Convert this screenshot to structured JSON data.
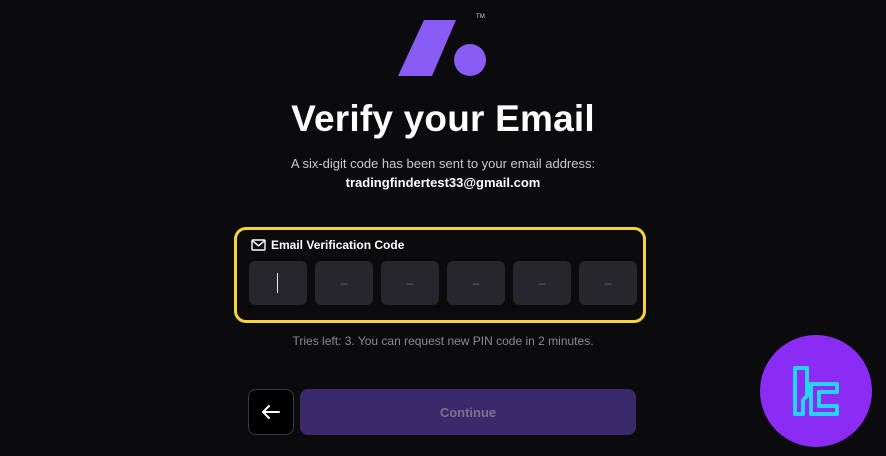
{
  "colors": {
    "background": "#0b0b0d",
    "brand_purple": "#8a5cf6",
    "highlight_yellow": "#f5d33b",
    "digit_box": "#27272b",
    "continue_disabled": "#3a2a6b",
    "badge_purple": "#8b2cf5",
    "badge_cyan": "#25d4f2"
  },
  "logo": {
    "icon": "brand-logo-icon",
    "trademark": "TM"
  },
  "heading": {
    "title": "Verify your Email",
    "subtitle": "A six-digit code has been sent to your email address:",
    "email": "tradingfindertest33@gmail.com"
  },
  "verification": {
    "label": "Email Verification Code",
    "label_icon": "envelope-icon",
    "digits": [
      {
        "placeholder": "",
        "active": true
      },
      {
        "placeholder": "–",
        "active": false
      },
      {
        "placeholder": "–",
        "active": false
      },
      {
        "placeholder": "–",
        "active": false
      },
      {
        "placeholder": "–",
        "active": false
      },
      {
        "placeholder": "–",
        "active": false
      }
    ]
  },
  "tries_text": "Tries left: 3. You can request new PIN code in 2 minutes.",
  "actions": {
    "back_icon": "arrow-left-icon",
    "continue_label": "Continue"
  },
  "watermark": {
    "icon": "tradingfinder-badge-icon"
  }
}
